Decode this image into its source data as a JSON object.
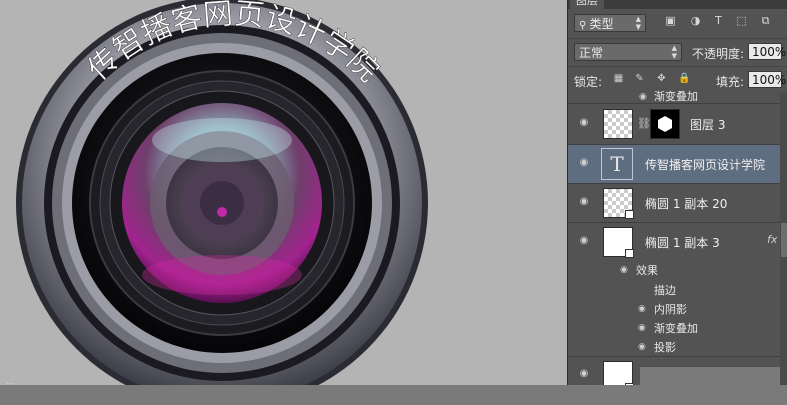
{
  "canvas": {
    "curved_text": "传智播客网页设计学院",
    "bottom_text": "..."
  },
  "colors": {
    "panel_bg": "#535353",
    "selected_layer": "#5f6d80",
    "lens_purple": "#8c2a7c",
    "lens_cyan": "#9cd6d6"
  },
  "panel": {
    "tab_title": "图层",
    "filter_kind": "类型",
    "filter_icons": [
      "image-icon",
      "adjustment-icon",
      "text-icon",
      "shape-icon",
      "smart-object-icon"
    ],
    "blend_mode": "正常",
    "opacity_label": "不透明度:",
    "opacity_value": "100%",
    "lock_label": "锁定:",
    "fill_label": "填充:",
    "fill_value": "100%"
  },
  "layers": {
    "partial_top_label": "渐变叠加",
    "items": [
      {
        "name": "图层 3",
        "type": "masked-layer",
        "selected": false
      },
      {
        "name": "传智播客网页设计学院",
        "type": "text",
        "selected": true
      },
      {
        "name": "椭圆 1 副本 20",
        "type": "shape",
        "selected": false
      },
      {
        "name": "椭圆 1 副本 3",
        "type": "shape",
        "selected": false,
        "fx": "fx"
      }
    ],
    "effects_header": "效果",
    "effects": [
      "描边",
      "内阴影",
      "渐变叠加",
      "投影"
    ]
  }
}
